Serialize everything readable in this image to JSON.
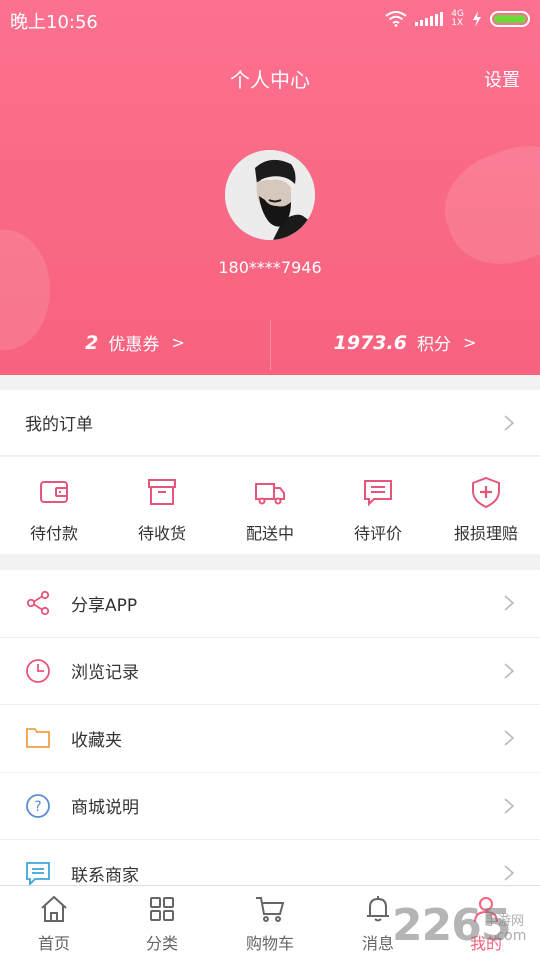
{
  "status_bar": {
    "time": "晚上10:56",
    "network_type": "4G",
    "network_speed": "1X"
  },
  "header": {
    "title": "个人中心",
    "settings_label": "设置",
    "phone": "180****7946"
  },
  "stats": {
    "coupons": {
      "value": "2",
      "label": "优惠券",
      "arrow": ">"
    },
    "points": {
      "value": "1973.6",
      "label": "积分",
      "arrow": ">"
    }
  },
  "orders": {
    "title": "我的订单",
    "statuses": [
      {
        "label": "待付款",
        "icon": "wallet-icon"
      },
      {
        "label": "待收货",
        "icon": "box-icon"
      },
      {
        "label": "配送中",
        "icon": "truck-icon"
      },
      {
        "label": "待评价",
        "icon": "comment-icon"
      },
      {
        "label": "报损理赔",
        "icon": "shield-plus-icon"
      }
    ]
  },
  "menu": [
    {
      "label": "分享APP",
      "icon": "share-icon"
    },
    {
      "label": "浏览记录",
      "icon": "clock-icon"
    },
    {
      "label": "收藏夹",
      "icon": "folder-icon"
    },
    {
      "label": "商城说明",
      "icon": "question-icon"
    },
    {
      "label": "联系商家",
      "icon": "message-icon"
    }
  ],
  "tabbar": [
    {
      "label": "首页",
      "icon": "home-icon"
    },
    {
      "label": "分类",
      "icon": "grid-icon"
    },
    {
      "label": "购物车",
      "icon": "cart-icon"
    },
    {
      "label": "消息",
      "icon": "bell-icon"
    },
    {
      "label": "我的",
      "icon": "user-icon",
      "active": true
    }
  ],
  "watermark": {
    "number": "2265",
    "site": "手游网",
    "domain": ".com"
  },
  "colors": {
    "accent": "#f7627f",
    "header_top": "#fd7190",
    "battery": "#6ed93a"
  }
}
